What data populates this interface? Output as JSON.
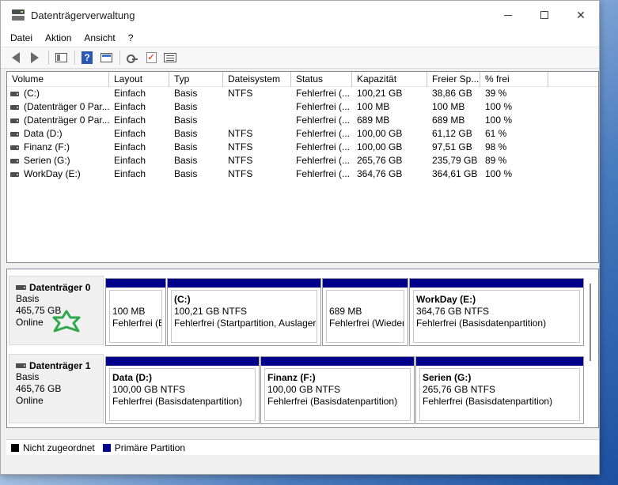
{
  "window": {
    "title": "Datenträgerverwaltung",
    "minimize": "—",
    "maximize": "☐",
    "close": "✕"
  },
  "menu": [
    "Datei",
    "Aktion",
    "Ansicht",
    "?"
  ],
  "toolbar": [
    "back-icon",
    "forward-icon",
    "console-tree-icon",
    "help-icon",
    "properties-icon",
    "rescan-icon",
    "check-icon",
    "list-icon"
  ],
  "volume_list": {
    "columns": [
      "Volume",
      "Layout",
      "Typ",
      "Dateisystem",
      "Status",
      "Kapazität",
      "Freier Sp...",
      "% frei"
    ],
    "rows": [
      [
        "(C:)",
        "Einfach",
        "Basis",
        "NTFS",
        "Fehlerfrei (...",
        "100,21 GB",
        "38,86 GB",
        "39 %"
      ],
      [
        "(Datenträger 0 Par...",
        "Einfach",
        "Basis",
        "",
        "Fehlerfrei (...",
        "100 MB",
        "100 MB",
        "100 %"
      ],
      [
        "(Datenträger 0 Par...",
        "Einfach",
        "Basis",
        "",
        "Fehlerfrei (...",
        "689 MB",
        "689 MB",
        "100 %"
      ],
      [
        "Data (D:)",
        "Einfach",
        "Basis",
        "NTFS",
        "Fehlerfrei (...",
        "100,00 GB",
        "61,12 GB",
        "61 %"
      ],
      [
        "Finanz (F:)",
        "Einfach",
        "Basis",
        "NTFS",
        "Fehlerfrei (...",
        "100,00 GB",
        "97,51 GB",
        "98 %"
      ],
      [
        "Serien (G:)",
        "Einfach",
        "Basis",
        "NTFS",
        "Fehlerfrei (...",
        "265,76 GB",
        "235,79 GB",
        "89 %"
      ],
      [
        "WorkDay (E:)",
        "Einfach",
        "Basis",
        "NTFS",
        "Fehlerfrei (...",
        "364,76 GB",
        "364,61 GB",
        "100 %"
      ]
    ]
  },
  "disks": [
    {
      "name": "Datenträger 0",
      "type": "Basis",
      "size": "465,75 GB",
      "state": "Online",
      "partitions": [
        {
          "label": "",
          "size": "100 MB",
          "status": "Fehlerfrei (E"
        },
        {
          "label": "(C:)",
          "size": "100,21 GB NTFS",
          "status": "Fehlerfrei (Startpartition, Auslageru"
        },
        {
          "label": "",
          "size": "689 MB",
          "status": "Fehlerfrei (Wiederl"
        },
        {
          "label": "WorkDay  (E:)",
          "size": "364,76 GB NTFS",
          "status": "Fehlerfrei (Basisdatenpartition)"
        }
      ]
    },
    {
      "name": "Datenträger 1",
      "type": "Basis",
      "size": "465,76 GB",
      "state": "Online",
      "partitions": [
        {
          "label": "Data  (D:)",
          "size": "100,00 GB NTFS",
          "status": "Fehlerfrei (Basisdatenpartition)"
        },
        {
          "label": "Finanz  (F:)",
          "size": "100,00 GB NTFS",
          "status": "Fehlerfrei (Basisdatenpartition)"
        },
        {
          "label": "Serien  (G:)",
          "size": "265,76 GB NTFS",
          "status": "Fehlerfrei (Basisdatenpartition)"
        }
      ]
    }
  ],
  "legend": [
    {
      "label": "Nicht zugeordnet",
      "color": "#000000"
    },
    {
      "label": "Primäre Partition",
      "color": "#00008b"
    }
  ],
  "colors": {
    "primary_partition": "#00008b",
    "unallocated": "#000000",
    "annotation_star": "#2ea84a"
  }
}
